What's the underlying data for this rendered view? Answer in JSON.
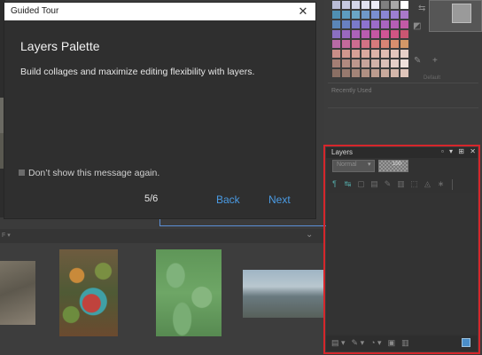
{
  "tour": {
    "title": "Guided Tour",
    "close_glyph": "✕",
    "heading": "Layers Palette",
    "body": "Build collages and maximize editing flexibility with layers.",
    "dont_show_label": "Don’t show this message again.",
    "step": "5/6",
    "back_label": "Back",
    "next_label": "Next",
    "link_color": "#4a9be4"
  },
  "palette": {
    "recent_label": "Recently Used",
    "default_label": "Default",
    "swatches": [
      "#b9bcd6",
      "#c6c9e0",
      "#d3d5e8",
      "#e1e2ef",
      "#eeeef6",
      "#7f7f7f",
      "#a8a8a8",
      "#ffffff",
      "#4f8fb2",
      "#5d9cc0",
      "#6aa6c6",
      "#6f98c9",
      "#7a8fd1",
      "#8a86d4",
      "#9c7fd2",
      "#a979c9",
      "#5a86b8",
      "#6880c2",
      "#7a7acb",
      "#8d73cf",
      "#9b6cc9",
      "#a965c0",
      "#b55eb5",
      "#c15aa6",
      "#8a6fc1",
      "#9a68bf",
      "#ab62b9",
      "#b95cb0",
      "#c557a3",
      "#cf5595",
      "#d05584",
      "#c95672",
      "#b86aa6",
      "#c46a9c",
      "#cd6c90",
      "#d37285",
      "#d67a7c",
      "#d88475",
      "#d88e6e",
      "#d39867",
      "#c98e88",
      "#d0978e",
      "#d6a096",
      "#daa99f",
      "#ddb3a8",
      "#e0bcb2",
      "#e3c6bd",
      "#e6d0c8",
      "#a47e74",
      "#b18a80",
      "#bc978d",
      "#c7a49b",
      "#d1b2a9",
      "#dbc0b8",
      "#e4cec8",
      "#ede0db",
      "#8a6f64",
      "#97796e",
      "#a38478",
      "#b09083",
      "#bc9c8f",
      "#c8a99c",
      "#d3b6aa",
      "#dfc5ba"
    ]
  },
  "bin": {
    "label": "F ▾",
    "chevron": "⌄"
  },
  "layers": {
    "title": "Layers",
    "window_icons": "▫ ▾ ⊞ ✕",
    "blend_mode": "Normal",
    "opacity": "100",
    "toolbar_icons": [
      "¶",
      "↹",
      "▢",
      "▤",
      "✎",
      "▥",
      "⬚",
      "◬",
      "∗"
    ],
    "bottom_icons": [
      "▤ ▾",
      "✎ ▾",
      "◔ ▾",
      "▣",
      "▥"
    ],
    "highlight_color": "#d6262b"
  }
}
